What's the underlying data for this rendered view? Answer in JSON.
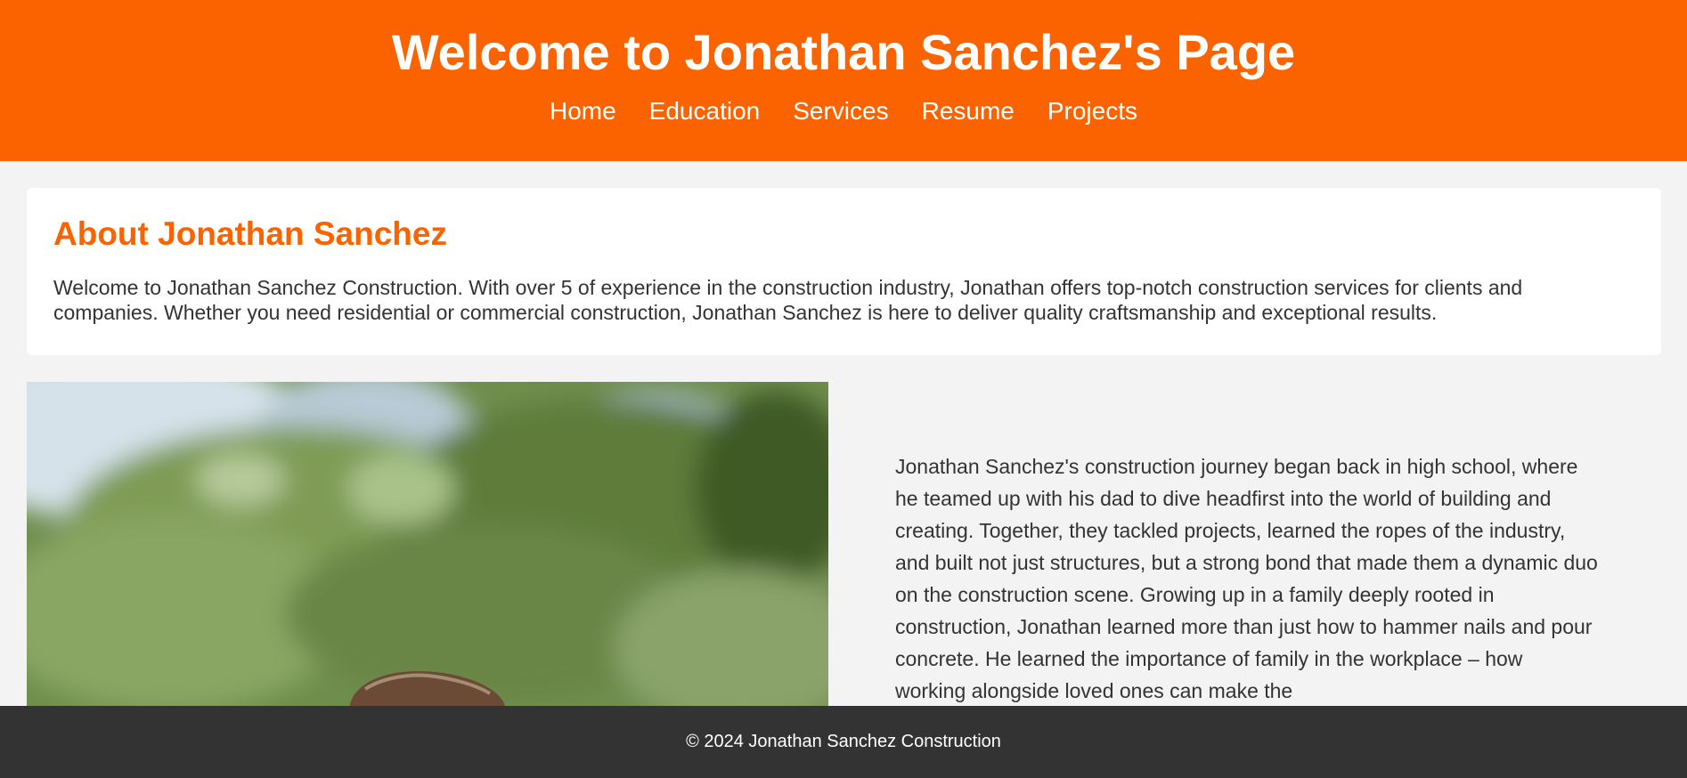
{
  "header": {
    "title": "Welcome to Jonathan Sanchez's Page",
    "nav": [
      "Home",
      "Education",
      "Services",
      "Resume",
      "Projects"
    ]
  },
  "about": {
    "heading": "About Jonathan Sanchez",
    "text": "Welcome to Jonathan Sanchez Construction. With over 5 of experience in the construction industry, Jonathan offers top-notch construction services for clients and companies. Whether you need residential or commercial construction, Jonathan Sanchez is here to deliver quality craftsmanship and exceptional results."
  },
  "story": {
    "text": "Jonathan Sanchez's construction journey began back in high school, where he teamed up with his dad to dive headfirst into the world of building and creating. Together, they tackled projects, learned the ropes of the industry, and built not just structures, but a strong bond that made them a dynamic duo on the construction scene. Growing up in a family deeply rooted in construction, Jonathan learned more than just how to hammer nails and pour concrete. He learned the importance of family in the workplace – how working alongside loved ones can make the"
  },
  "footer": {
    "text": "© 2024 Jonathan Sanchez Construction"
  },
  "colors": {
    "brand": "#fa6300",
    "footer_bg": "#333333",
    "page_bg": "#f3f3f3"
  }
}
